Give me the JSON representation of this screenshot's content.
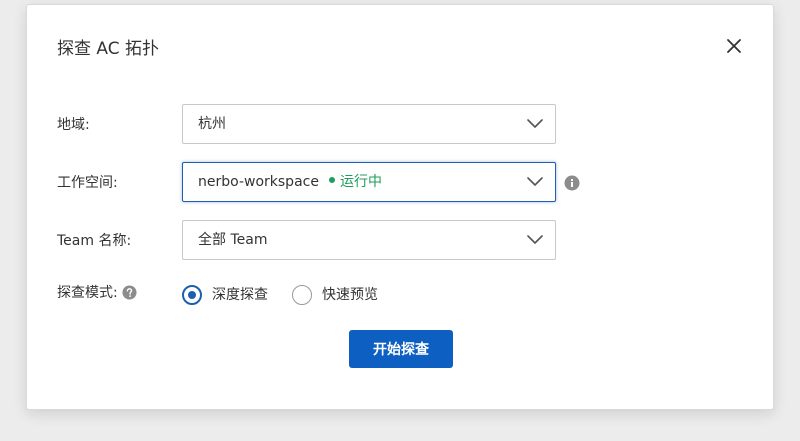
{
  "dialog": {
    "title": "探查 AC 拓扑",
    "close_icon": "close-icon"
  },
  "form": {
    "region": {
      "label": "地域:",
      "value": "杭州"
    },
    "workspace": {
      "label": "工作空间:",
      "value": "nerbo-workspace",
      "status": "运行中",
      "status_color": "#1e9e5a",
      "info_icon": "info-icon"
    },
    "team": {
      "label": "Team 名称:",
      "value": "全部 Team"
    },
    "mode": {
      "label": "探查模式:",
      "help_icon": "question-icon",
      "options": [
        {
          "label": "深度探查",
          "checked": true
        },
        {
          "label": "快速预览",
          "checked": false
        }
      ]
    }
  },
  "actions": {
    "start_label": "开始探查"
  },
  "colors": {
    "primary": "#0d5fc2",
    "focus_border": "#1f5fb0"
  }
}
